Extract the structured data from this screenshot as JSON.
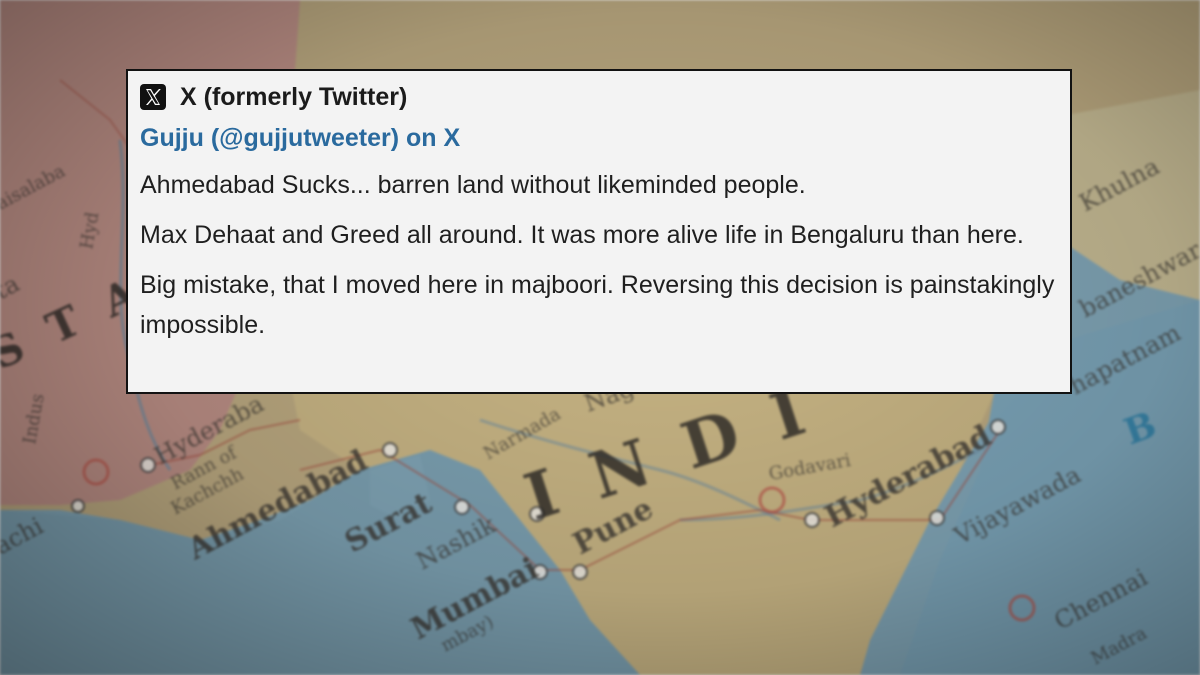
{
  "card": {
    "source": "X (formerly Twitter)",
    "author": "Gujju (@gujjutweeter) on X",
    "paragraphs": [
      "Ahmedabad Sucks... barren land without likeminded people.",
      "Max Dehaat and Greed all around. It was more alive life in Bengaluru than here.",
      "Big mistake, that I moved here in majboori. Reversing this decision is painstakingly impossible."
    ],
    "logo_icon": "x-logo-icon"
  },
  "map": {
    "labels": {
      "india": "I N D I",
      "ahmedabad": "Ahmedabad",
      "surat": "Surat",
      "nashik": "Nashik",
      "pune": "Pune",
      "mumbai": "Mumbai",
      "hyderabad_east": "Hyderabad",
      "hyderabad_west": "Hyderaba",
      "vijayawada": "Vijayawada",
      "visakhapatnam": "hapatnam",
      "chennai": "Chennai",
      "khulna": "Khulna",
      "bhubaneshwar": "baneshwar",
      "karachi": "achi",
      "rann": "Rann of",
      "kachchh": "Kachchh",
      "indus": "Indus",
      "narmada": "Narmada",
      "godavari": "Godavari",
      "nagpur": "Nag",
      "bay": "B",
      "bombay": "mbay)",
      "madras": "Madra",
      "sta": "S T A",
      "faisalabad": "aisalaba",
      "ta": "ta",
      "hyd_ta": "Hyd"
    },
    "colors": {
      "land_main": "#b9a77f",
      "land_india": "#c6b383",
      "land_pakistan": "#b98d84",
      "sea": "#7fa3b4",
      "sea_deep": "#5f8495",
      "accent_blue": "#2a6a9e"
    }
  }
}
